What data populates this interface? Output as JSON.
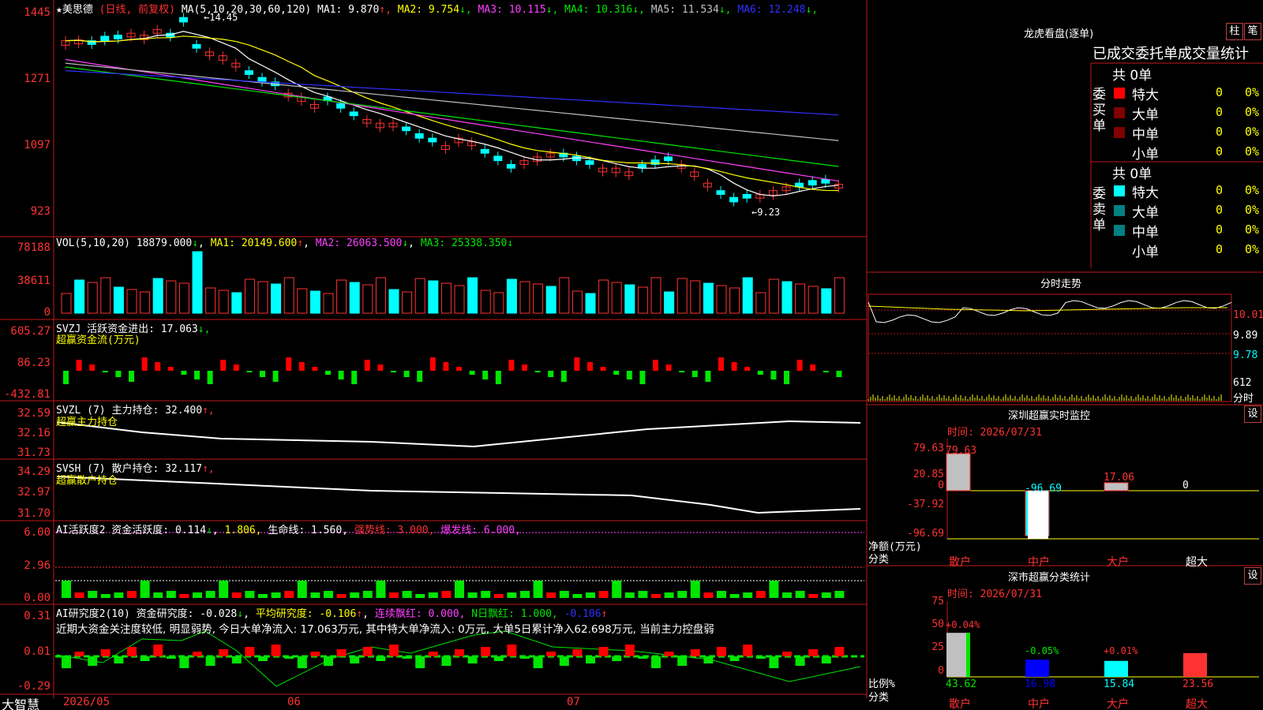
{
  "stock": {
    "title": "美思德",
    "mode": "(日线, 前复权)",
    "ma_label": "MA(5,10,20,30,60,120)",
    "ma": [
      {
        "k": "MA1:",
        "v": "9.870",
        "arr": "↑",
        "c": "#ffffff"
      },
      {
        "k": "MA2:",
        "v": "9.754",
        "arr": "↓",
        "c": "#ffff00"
      },
      {
        "k": "MA3:",
        "v": "10.115",
        "arr": "↓",
        "c": "#ff40ff"
      },
      {
        "k": "MA4:",
        "v": "10.316",
        "arr": "↓",
        "c": "#00e600"
      },
      {
        "k": "MA5:",
        "v": "11.534",
        "arr": "↓",
        "c": "#c0c0c0"
      },
      {
        "k": "MA6:",
        "v": "12.248",
        "arr": "↓",
        "c": "#3030ff"
      }
    ],
    "y_ticks": [
      "1445",
      "1271",
      "1097",
      "923"
    ],
    "high_mark": "14.45",
    "low_mark": "9.23"
  },
  "vol": {
    "label": "VOL(5,10,20)",
    "v": "18879.000",
    "ma1": "MA1: 20149.600",
    "ma2": "MA2: 26063.500",
    "ma3": "MA3: 25338.350",
    "arrows": [
      "↓",
      "↑",
      "↓",
      "↓"
    ],
    "y_ticks": [
      "78188",
      "38611",
      "0"
    ]
  },
  "svzj": {
    "label": "SVZJ  活跃资金进出: 17.063",
    "sub": "超赢资金流(万元)",
    "y_ticks": [
      "605.27",
      "86.23",
      "-432.81"
    ],
    "arr": "↓,"
  },
  "svzl": {
    "label": "SVZL (7) 主力持仓: 32.400",
    "sub": "超赢主力持仓",
    "y_ticks": [
      "32.59",
      "32.16",
      "31.73"
    ],
    "arr": "↑,"
  },
  "svsh": {
    "label": "SVSH (7) 散户持仓: 32.117",
    "sub": "超赢散户持仓",
    "y_ticks": [
      "34.29",
      "32.97",
      "31.70"
    ],
    "arr": "↑,"
  },
  "ai1": {
    "label": "AI活跃度2 资金活跃度: 0.114",
    "v2": "1.806,",
    "v3": "生命线: 1.560,",
    "v4": "强势线: 3.000,",
    "v5": "爆发线: 6.000,",
    "y_ticks": [
      "6.00",
      "2.96",
      "0.00"
    ]
  },
  "ai2": {
    "label": "AI研究度2(10) 资金研究度: -0.028",
    "v2": "平均研究度: -0.106",
    "v3": "连续飘红: 0.000,",
    "v4": "N日飘红: 1.000,",
    "v5": "-0.106",
    "y_ticks": [
      "0.31",
      "0.01",
      "-0.29"
    ],
    "comment": "近期大资金关注度较低, 明显弱势, 今日大单净流入: 17.063万元, 其中特大单净流入: 0万元, 大单5日累计净入62.698万元, 当前主力控盘弱"
  },
  "bottom": {
    "brand": "大智慧",
    "dates": [
      "2026/05",
      "06",
      "07"
    ]
  },
  "right": {
    "title": "龙虎看盘(逐单)",
    "btn1": "柱",
    "btn2": "笔",
    "stats_header": "已成交委托单成交量统计",
    "buy": {
      "label": "委买单",
      "total": "共 0单",
      "rows": [
        {
          "n": "特大",
          "v": "0",
          "p": "0%",
          "c": "#ff0000"
        },
        {
          "n": "大单",
          "v": "0",
          "p": "0%",
          "c": "#800000"
        },
        {
          "n": "中单",
          "v": "0",
          "p": "0%",
          "c": "#800000"
        },
        {
          "n": "小单",
          "v": "0",
          "p": "0%",
          "c": "#000000"
        }
      ]
    },
    "sell": {
      "label": "委卖单",
      "total": "共 0单",
      "rows": [
        {
          "n": "特大",
          "v": "0",
          "p": "0%",
          "c": "#00ffff"
        },
        {
          "n": "大单",
          "v": "0",
          "p": "0%",
          "c": "#008080"
        },
        {
          "n": "中单",
          "v": "0",
          "p": "0%",
          "c": "#008080"
        },
        {
          "n": "小单",
          "v": "0",
          "p": "0%",
          "c": "#000000"
        }
      ]
    },
    "intraday": {
      "title": "分时走势",
      "y": [
        "10.01",
        "9.89",
        "9.78"
      ],
      "vol": "612",
      "unit": "分时"
    },
    "monitor": {
      "title": "深圳超赢实时监控",
      "btn": "设",
      "time": "时间: 2026/07/31",
      "y": [
        "79.63",
        "20.85",
        "0",
        "-37.92",
        "-96.69"
      ],
      "ylabel": "净额(万元)",
      "xlabel": "分类",
      "cats": [
        "散户",
        "中户",
        "大户",
        "超大"
      ],
      "vals": [
        "79.63",
        "-96.69",
        "17.06",
        "0"
      ]
    },
    "classify": {
      "title": "深市超赢分类统计",
      "btn": "设",
      "time": "时间: 2026/07/31",
      "y": [
        "75",
        "50",
        "25",
        "0"
      ],
      "ylabel": "比例%",
      "xlabel": "分类",
      "cats": [
        "散户",
        "中户",
        "大户",
        "超大"
      ],
      "vals": [
        "43.62",
        "16.98",
        "15.84",
        "23.56"
      ],
      "deltas": [
        "+0.04%",
        "-0.05%",
        "+0.01%",
        ""
      ]
    }
  }
}
